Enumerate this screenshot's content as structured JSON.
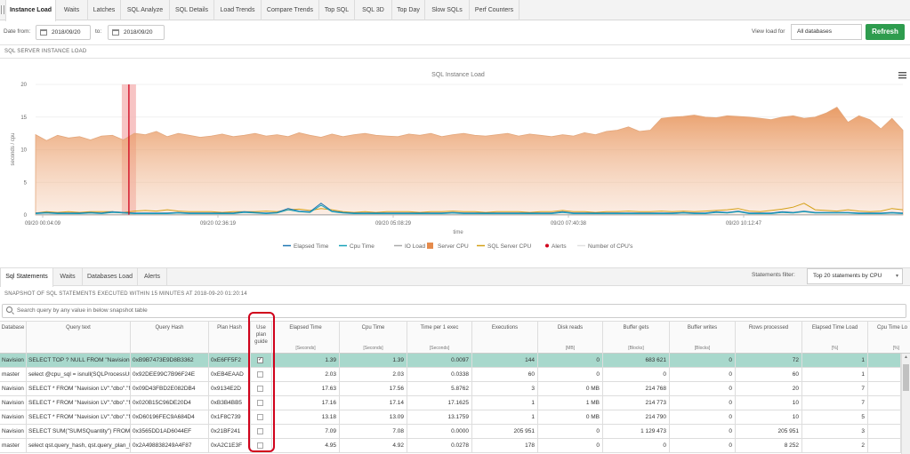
{
  "top_tabs": [
    "Instance Load",
    "Waits",
    "Latches",
    "SQL Analyze",
    "SQL Details",
    "Load Trends",
    "Compare Trends",
    "Top SQL",
    "SQL 3D",
    "Top Day",
    "Slow SQLs",
    "Perf Counters"
  ],
  "filters": {
    "date_from_label": "Date from:",
    "date_from": "2018/09/20",
    "to_label": "to:",
    "date_to": "2018/09/20",
    "view_load_label": "View load for",
    "view_load_value": "All databases",
    "refresh_label": "Refresh"
  },
  "section_title": "SQL SERVER INSTANCE LOAD",
  "chart_data": {
    "type": "area",
    "title": "SQL Instance Load",
    "ylabel": "seconds / cpu",
    "xlabel": "time",
    "ylim": [
      0,
      20
    ],
    "yticks": [
      0,
      5,
      10,
      15,
      20
    ],
    "xtick_labels": [
      "09/20 00:04:09",
      "09/20 02:36:19",
      "09/20 05:08:29",
      "09/20 07:40:38",
      "09/20 10:12:47"
    ],
    "alert_marker_at": "09/20 01:20:14",
    "legend_position": "bottom",
    "series": [
      {
        "name": "Elapsed Time",
        "color": "#1f77b4",
        "values": [
          0.3,
          0.4,
          0.3,
          0.3,
          0.3,
          0.4,
          0.3,
          0.5,
          0.4,
          0.3,
          0.3,
          0.3,
          0.3,
          0.4,
          0.3,
          0.3,
          0.3,
          0.3,
          0.3,
          0.5,
          0.4,
          0.3,
          0.4,
          1.0,
          0.6,
          0.5,
          1.8,
          0.6,
          0.4,
          0.3,
          0.3,
          0.3,
          0.3,
          0.3,
          0.3,
          0.3,
          0.3,
          0.3,
          0.4,
          0.3,
          0.3,
          0.3,
          0.3,
          0.3,
          0.3,
          0.3,
          0.3,
          0.3,
          0.5,
          0.3,
          0.3,
          0.3,
          0.3,
          0.3,
          0.3,
          0.3,
          0.3,
          0.3,
          0.3,
          0.4,
          0.3,
          0.3,
          0.5,
          0.4,
          0.6,
          0.3,
          0.3,
          0.3,
          0.5,
          0.4,
          0.6,
          0.4,
          0.4,
          0.4,
          0.4,
          0.3,
          0.3,
          0.3,
          0.4,
          0.3
        ]
      },
      {
        "name": "Cpu Time",
        "color": "#17a2b8",
        "values": [
          0.2,
          0.3,
          0.2,
          0.2,
          0.2,
          0.3,
          0.2,
          0.4,
          0.3,
          0.2,
          0.2,
          0.2,
          0.2,
          0.3,
          0.2,
          0.2,
          0.2,
          0.2,
          0.2,
          0.4,
          0.3,
          0.2,
          0.3,
          0.8,
          0.5,
          0.4,
          1.5,
          0.5,
          0.3,
          0.2,
          0.2,
          0.2,
          0.2,
          0.2,
          0.2,
          0.2,
          0.2,
          0.2,
          0.3,
          0.2,
          0.2,
          0.2,
          0.2,
          0.2,
          0.2,
          0.2,
          0.2,
          0.2,
          0.4,
          0.2,
          0.2,
          0.2,
          0.2,
          0.2,
          0.2,
          0.2,
          0.2,
          0.2,
          0.2,
          0.3,
          0.2,
          0.2,
          0.4,
          0.3,
          0.5,
          0.2,
          0.2,
          0.2,
          0.4,
          0.3,
          0.5,
          0.3,
          0.3,
          0.3,
          0.3,
          0.2,
          0.2,
          0.2,
          0.3,
          0.2
        ]
      },
      {
        "name": "IO Load",
        "color": "#aaaaaa",
        "values": [
          0.05,
          0.05,
          0.05,
          0.05,
          0.05,
          0.05,
          0.05,
          0.05,
          0.05,
          0.05,
          0.05,
          0.05,
          0.05,
          0.05,
          0.05,
          0.05,
          0.05,
          0.05,
          0.05,
          0.05,
          0.05,
          0.05,
          0.05,
          0.05,
          0.05,
          0.05,
          0.05,
          0.05,
          0.05,
          0.05,
          0.05,
          0.05,
          0.05,
          0.05,
          0.05,
          0.05,
          0.05,
          0.05,
          0.05,
          0.05,
          0.05,
          0.05,
          0.05,
          0.05,
          0.05,
          0.05,
          0.05,
          0.05,
          0.05,
          0.05,
          0.05,
          0.05,
          0.05,
          0.05,
          0.05,
          0.05,
          0.05,
          0.05,
          0.05,
          0.05,
          0.05,
          0.05,
          0.05,
          0.05,
          0.05,
          0.05,
          0.05,
          0.05,
          0.05,
          0.05,
          0.05,
          0.05,
          0.05,
          0.05,
          0.05,
          0.05,
          0.05,
          0.05,
          0.05,
          0.05
        ]
      },
      {
        "name": "Server CPU",
        "color": "#e58b4c",
        "values": [
          12.3,
          11.4,
          12.2,
          11.8,
          12.0,
          11.5,
          12.1,
          12.2,
          11.5,
          12.5,
          12.3,
          12.8,
          12.0,
          12.5,
          12.2,
          11.9,
          12.1,
          12.4,
          12.0,
          12.2,
          12.5,
          12.1,
          12.3,
          12.0,
          12.6,
          12.2,
          11.9,
          12.4,
          12.0,
          12.3,
          12.5,
          12.2,
          12.1,
          12.0,
          12.4,
          12.2,
          12.5,
          12.0,
          12.3,
          12.5,
          12.2,
          12.1,
          12.3,
          12.5,
          12.1,
          12.4,
          12.2,
          12.0,
          12.3,
          12.1,
          12.6,
          12.3,
          12.8,
          13.0,
          13.5,
          12.8,
          13.0,
          14.8,
          15.0,
          15.1,
          15.3,
          15.0,
          14.9,
          15.2,
          15.1,
          15.0,
          14.8,
          14.6,
          15.0,
          15.2,
          14.8,
          15.0,
          15.6,
          16.5,
          14.2,
          15.2,
          14.6,
          13.2,
          14.8,
          13.0
        ]
      },
      {
        "name": "SQL Server CPU",
        "color": "#d4a017",
        "values": [
          0.3,
          0.5,
          0.4,
          0.5,
          0.4,
          0.5,
          0.5,
          0.5,
          0.4,
          0.6,
          0.7,
          0.6,
          0.8,
          0.6,
          0.5,
          0.5,
          0.5,
          0.4,
          0.5,
          0.5,
          0.5,
          0.6,
          0.5,
          0.8,
          0.9,
          0.7,
          1.0,
          0.8,
          0.5,
          0.4,
          0.5,
          0.4,
          0.5,
          0.5,
          0.5,
          0.4,
          0.5,
          0.5,
          0.6,
          0.5,
          0.5,
          0.4,
          0.5,
          0.5,
          0.5,
          0.4,
          0.5,
          0.5,
          0.7,
          0.5,
          0.5,
          0.4,
          0.5,
          0.5,
          0.6,
          0.5,
          0.5,
          0.6,
          0.5,
          0.6,
          0.5,
          0.6,
          0.7,
          0.8,
          1.0,
          0.6,
          0.5,
          0.7,
          0.9,
          1.2,
          1.8,
          0.8,
          0.7,
          0.6,
          0.8,
          0.6,
          0.5,
          0.6,
          1.0,
          0.8
        ]
      },
      {
        "name": "Alerts",
        "color": "#d0021b",
        "values": []
      },
      {
        "name": "Number of CPU's",
        "color": "#e0e0e0",
        "values": []
      }
    ]
  },
  "bottom_tabs": [
    "Sql Statements",
    "Waits",
    "Databases Load",
    "Alerts"
  ],
  "statements_filter": {
    "label": "Statements filter:",
    "value": "Top 20 statements by CPU"
  },
  "snapshot_title": "SNAPSHOT OF SQL STATEMENTS EXECUTED WITHIN 15 MINUTES AT 2018-09-20 01:20:14",
  "search_placeholder": "Search query by any value in below snapshot table",
  "table": {
    "columns": [
      {
        "label": "Database",
        "unit": ""
      },
      {
        "label": "Query text",
        "unit": ""
      },
      {
        "label": "Query Hash",
        "unit": ""
      },
      {
        "label": "Plan Hash",
        "unit": ""
      },
      {
        "label": "Use plan guide",
        "unit": ""
      },
      {
        "label": "Elapsed Time",
        "unit": "[Seconds]"
      },
      {
        "label": "Cpu Time",
        "unit": "[Seconds]"
      },
      {
        "label": "Time per 1 exec",
        "unit": "[Seconds]"
      },
      {
        "label": "Executions",
        "unit": ""
      },
      {
        "label": "Disk reads",
        "unit": "[MB]"
      },
      {
        "label": "Buffer gets",
        "unit": "[Blocks]"
      },
      {
        "label": "Buffer writes",
        "unit": "[Blocks]"
      },
      {
        "label": "Rows processed",
        "unit": ""
      },
      {
        "label": "Elapsed Time Load",
        "unit": "[%]"
      },
      {
        "label": "Cpu Time Lo",
        "unit": "[%]"
      }
    ],
    "rows": [
      [
        "Navision L",
        "SELECT TOP ? NULL FROM \"Navision",
        "0xB9B7473E9D8B3362",
        "0xE6FF5F2",
        "checked",
        "1.39",
        "1.39",
        "0.0097",
        "144",
        "0",
        "683 621",
        "0",
        "72",
        "1",
        ""
      ],
      [
        "master",
        "select @cpu_sql = isnull(SQLProcessUti",
        "0x92DEE99C7B96F24E",
        "0xEB4EAAD",
        "",
        "2.03",
        "2.03",
        "0.0338",
        "60",
        "0",
        "0",
        "0",
        "60",
        "1",
        ""
      ],
      [
        "Navision L",
        "SELECT * FROM \"Navision LV\".\"dbo\".\"N",
        "0x09D43FBD2E082DB4",
        "0x9134E2D",
        "",
        "17.63",
        "17.56",
        "5.8762",
        "3",
        "0 MB",
        "214 768",
        "0",
        "20",
        "7",
        ""
      ],
      [
        "Navision L",
        "SELECT * FROM \"Navision LV\".\"dbo\".\"N",
        "0x020B15C96DE20D4",
        "0xB3B4BB5",
        "",
        "17.16",
        "17.14",
        "17.1625",
        "1",
        "1 MB",
        "214 773",
        "0",
        "10",
        "7",
        ""
      ],
      [
        "Navision L",
        "SELECT * FROM \"Navision LV\".\"dbo\".\"N",
        "0xD60196FEC9A684D4",
        "0x1F8C739",
        "",
        "13.18",
        "13.09",
        "13.1759",
        "1",
        "0 MB",
        "214 790",
        "0",
        "10",
        "5",
        ""
      ],
      [
        "Navision L",
        "SELECT SUM(\"SUMSQuantity\") FROM \"",
        "0x3565DD1AD6044EF",
        "0x21BF241",
        "",
        "7.09",
        "7.08",
        "0.0000",
        "205 951",
        "0",
        "1 129 473",
        "0",
        "205 951",
        "3",
        ""
      ],
      [
        "master",
        "select qst.query_hash, qst.query_plan_h",
        "0x2A498838249A4F87",
        "0xA2C1E3F",
        "",
        "4.95",
        "4.92",
        "0.0278",
        "178",
        "0",
        "0",
        "0",
        "8 252",
        "2",
        ""
      ]
    ]
  }
}
